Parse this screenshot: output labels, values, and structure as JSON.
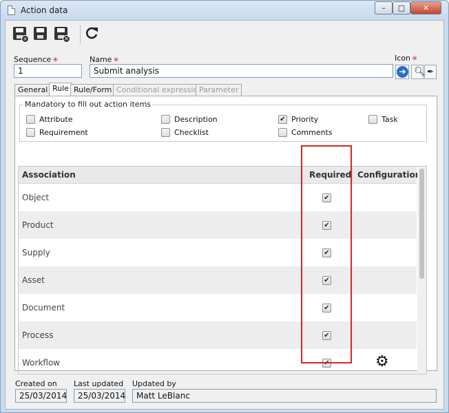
{
  "window": {
    "title": "Action data",
    "controls": {
      "minimize": "–",
      "maximize": "□",
      "close": "✕"
    }
  },
  "toolbar": {
    "buttons": [
      {
        "name": "save-new-button",
        "icon": "save-plus-icon"
      },
      {
        "name": "save-button",
        "icon": "save-icon"
      },
      {
        "name": "save-close-button",
        "icon": "save-close-icon"
      },
      {
        "name": "refresh-button",
        "icon": "refresh-icon"
      }
    ]
  },
  "fields": {
    "sequence_label": "Sequence",
    "sequence_value": "1",
    "name_label": "Name",
    "name_value": "Submit analysis",
    "icon_label": "Icon",
    "required_mark": "✳"
  },
  "tabs": [
    {
      "label": "General",
      "state": "normal"
    },
    {
      "label": "Rule",
      "state": "active"
    },
    {
      "label": "Rule/Form",
      "state": "normal"
    },
    {
      "label": "Conditional expression",
      "state": "disabled"
    },
    {
      "label": "Parameter",
      "state": "disabled"
    }
  ],
  "mandatory": {
    "title": "Mandatory to fill out action items",
    "items": [
      {
        "label": "Attribute",
        "checked": false
      },
      {
        "label": "Description",
        "checked": false
      },
      {
        "label": "Priority",
        "checked": true
      },
      {
        "label": "Task",
        "checked": false
      },
      {
        "label": "Requirement",
        "checked": false
      },
      {
        "label": "Checklist",
        "checked": false
      },
      {
        "label": "Comments",
        "checked": false
      }
    ]
  },
  "grid": {
    "headers": {
      "association": "Association",
      "required": "Required",
      "configuration": "Configuration"
    },
    "rows": [
      {
        "association": "Object",
        "required": true,
        "config": false
      },
      {
        "association": "Product",
        "required": true,
        "config": false
      },
      {
        "association": "Supply",
        "required": true,
        "config": false
      },
      {
        "association": "Asset",
        "required": true,
        "config": false
      },
      {
        "association": "Document",
        "required": true,
        "config": false
      },
      {
        "association": "Process",
        "required": true,
        "config": false
      },
      {
        "association": "Workflow",
        "required": true,
        "config": true
      }
    ]
  },
  "footer": {
    "created_label": "Created on",
    "created_value": "25/03/2014",
    "updated_label": "Last updated",
    "updated_value": "25/03/2014",
    "updated_by_label": "Updated by",
    "updated_by_value": "Matt LeBlanc"
  },
  "colors": {
    "highlight": "#d72323",
    "required_mark": "#d21b1b",
    "icon_arrow": "#2a6fbf"
  }
}
